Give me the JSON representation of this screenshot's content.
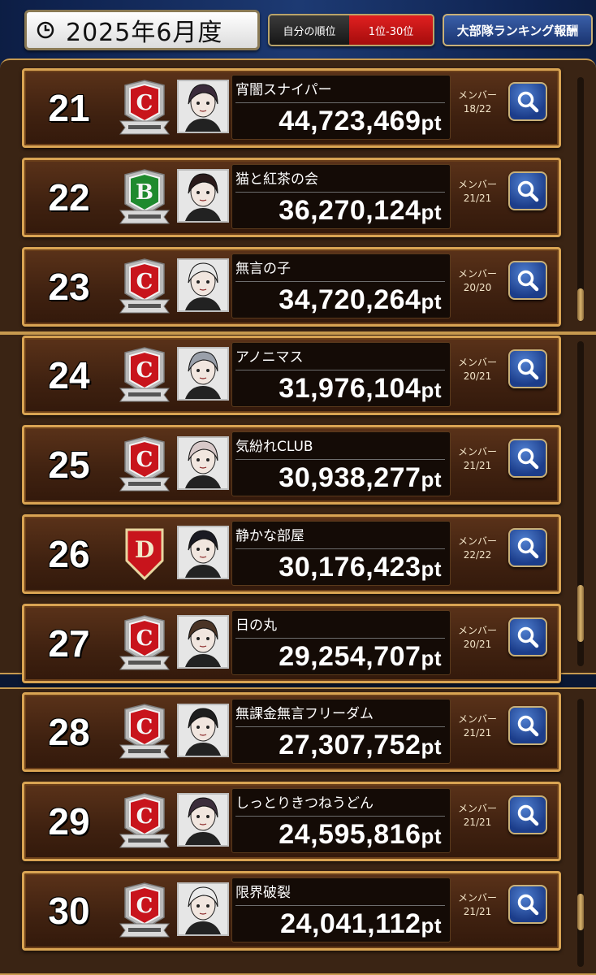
{
  "header": {
    "month_label": "2025年6月度",
    "rank_toggle_label": "自分の順位",
    "rank_range_label": "1位-30位",
    "reward_button_label": "大部隊ランキング報酬"
  },
  "member_label": "メンバー",
  "colors": {
    "rank_C": "#c8141c",
    "rank_B": "#1f8a2e",
    "rank_D": "#c8141c",
    "accent_gold": "#d9a453",
    "search_blue": "#2a58b8"
  },
  "rows": [
    {
      "rank": "21",
      "emblem": "C",
      "name": "宵闇スナイパー",
      "score": "44,723,469",
      "unit": "pt",
      "members": "18/22"
    },
    {
      "rank": "22",
      "emblem": "B",
      "name": "猫と紅茶の会",
      "score": "36,270,124",
      "unit": "pt",
      "members": "21/21"
    },
    {
      "rank": "23",
      "emblem": "C",
      "name": "無言の子",
      "score": "34,720,264",
      "unit": "pt",
      "members": "20/20"
    },
    {
      "rank": "24",
      "emblem": "C",
      "name": "アノニマス",
      "score": "31,976,104",
      "unit": "pt",
      "members": "20/21"
    },
    {
      "rank": "25",
      "emblem": "C",
      "name": "気紛れCLUB",
      "score": "30,938,277",
      "unit": "pt",
      "members": "21/21"
    },
    {
      "rank": "26",
      "emblem": "D",
      "name": "静かな部屋",
      "score": "30,176,423",
      "unit": "pt",
      "members": "22/22"
    },
    {
      "rank": "27",
      "emblem": "C",
      "name": "日の丸",
      "score": "29,254,707",
      "unit": "pt",
      "members": "20/21"
    },
    {
      "rank": "28",
      "emblem": "C",
      "name": "無課金無言フリーダム",
      "score": "27,307,752",
      "unit": "pt",
      "members": "21/21"
    },
    {
      "rank": "29",
      "emblem": "C",
      "name": "しっとりきつねうどん",
      "score": "24,595,816",
      "unit": "pt",
      "members": "21/21"
    },
    {
      "rank": "30",
      "emblem": "C",
      "name": "限界破裂",
      "score": "24,041,112",
      "unit": "pt",
      "members": "21/21"
    }
  ]
}
